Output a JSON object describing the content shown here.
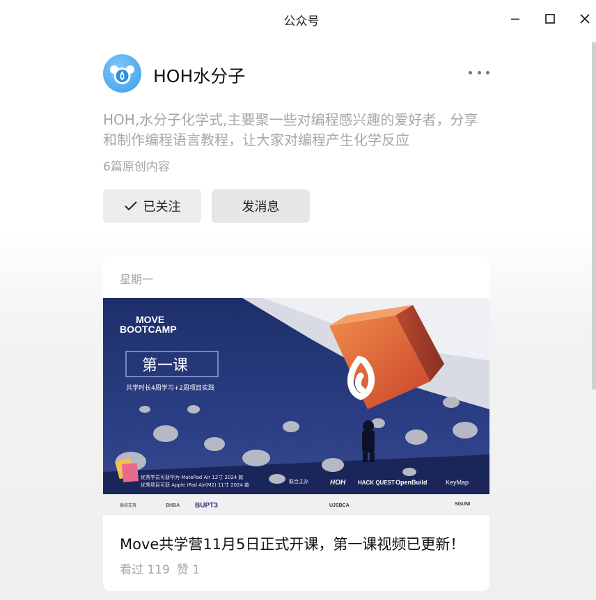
{
  "window": {
    "title": "公众号"
  },
  "account": {
    "name": "HOH水分子",
    "description": "HOH,水分子化学式,主要聚一些对编程感兴趣的爱好者，分享和制作编程语言教程，让大家对编程产生化学反应",
    "original_count": "6篇原创内容",
    "follow_label": "已关注",
    "message_label": "发消息"
  },
  "article": {
    "day": "星期一",
    "title": "Move共学营11月5日正式开课，第一课视频已更新！",
    "views": "看过 119",
    "likes": "赞 1",
    "cover": {
      "headline": "第一课",
      "brand_top": "MOVE",
      "brand_bottom": "BOOTCAMP",
      "duration": "共学时长4周学习+2周项目实践",
      "prize_line1": "优秀学员可获华为 MatePad Air 12寸 2024 款",
      "prize_line2": "优秀项目可获 Apple iPad Air(M2) 11寸 2024 款",
      "organizer_label": "联合主办",
      "sponsors": [
        "HOH",
        "HACK QUEST",
        "OpenBuild",
        "KeyMap"
      ],
      "schools_label": "高校支持",
      "schools": [
        "BHBA",
        "BUPT3",
        "UJSBCA",
        "SGUNI"
      ]
    }
  },
  "colors": {
    "accent": "#3a9de8",
    "text_muted": "#a6a6a6"
  },
  "icons": [
    "minimize-icon",
    "maximize-icon",
    "close-icon",
    "more-icon",
    "check-icon"
  ]
}
